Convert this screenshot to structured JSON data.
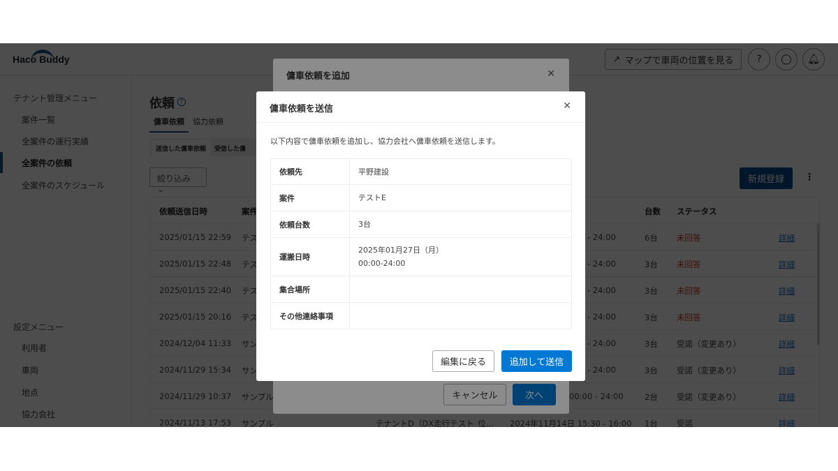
{
  "header": {
    "logo": "Haco Buddy",
    "map_button": "マップで車両の位置を見る"
  },
  "sidebar": {
    "tenant_section": "テナント管理メニュー",
    "tenant_items": [
      "案件一覧",
      "全案件の運行実績",
      "全案件の依頼",
      "全案件のスケジュール"
    ],
    "settings_section": "設定メニュー",
    "settings_items": [
      "利用者",
      "車両",
      "地点",
      "協力会社"
    ]
  },
  "main": {
    "title": "依頼",
    "tabs": [
      "傭車依頼",
      "協力依頼"
    ],
    "segments": [
      "送信した傭車依頼",
      "受信した傭"
    ],
    "filter": "絞り込み",
    "new_button": "新規登録",
    "columns": {
      "sent": "依頼送信日時",
      "case": "案件",
      "count": "台数",
      "status": "ステータス"
    },
    "rows": [
      {
        "sent": "2025/01/15 22:59",
        "case": "テス",
        "partner": "",
        "time": "0 - 24:00",
        "count": "6台",
        "status": "未回答",
        "link": "詳細"
      },
      {
        "sent": "2025/01/15 22:48",
        "case": "テス",
        "partner": "",
        "time": "0 - 24:00",
        "count": "3台",
        "status": "未回答",
        "link": "詳細"
      },
      {
        "sent": "2025/01/15 22:40",
        "case": "テス",
        "partner": "",
        "time": "0 - 24:00",
        "count": "3台",
        "status": "未回答",
        "link": "詳細"
      },
      {
        "sent": "2025/01/15 20:16",
        "case": "テス",
        "partner": "",
        "time": "0 - 24:00",
        "count": "3台",
        "status": "未回答",
        "link": "詳細"
      },
      {
        "sent": "2024/12/04 11:33",
        "case": "サン",
        "partner": "",
        "time": "0 - 24:00",
        "count": "3台",
        "status": "受諾（変更あり）",
        "link": "詳細"
      },
      {
        "sent": "2024/11/29 15:34",
        "case": "サン",
        "partner": "",
        "time": "0 - 24:00",
        "count": "3台",
        "status": "受諾（変更あり）",
        "link": "詳細"
      },
      {
        "sent": "2024/11/29 10:37",
        "case": "サンプル",
        "partner": "",
        "time": "00:00 - 24:00",
        "count": "2台",
        "status": "受諾（変更あり）",
        "link": "詳細"
      },
      {
        "sent": "2024/11/13 17:53",
        "case": "サンプル",
        "partner": "テナントD（DX走行テスト_位...",
        "time": "2024年11月14日 15:30 - 16:00",
        "count": "1台",
        "status": "受諾",
        "link": "詳細"
      }
    ]
  },
  "modal_add": {
    "title": "傭車依頼を追加",
    "cancel": "キャンセル",
    "next": "次へ"
  },
  "modal_send": {
    "title": "傭車依頼を送信",
    "description": "以下内容で傭車依頼を追加し、協力会社へ傭車依頼を送信します。",
    "fields": [
      {
        "label": "依頼先",
        "value": "平野建設",
        "value2": ""
      },
      {
        "label": "案件",
        "value": "テストE",
        "value2": ""
      },
      {
        "label": "依頼台数",
        "value": "3台",
        "value2": ""
      },
      {
        "label": "運搬日時",
        "value": "2025年01月27日（月）",
        "value2": "00:00-24:00"
      },
      {
        "label": "集合場所",
        "value": "",
        "value2": ""
      },
      {
        "label": "その他連絡事項",
        "value": "",
        "value2": ""
      }
    ],
    "back": "編集に戻る",
    "submit": "追加して送信"
  }
}
